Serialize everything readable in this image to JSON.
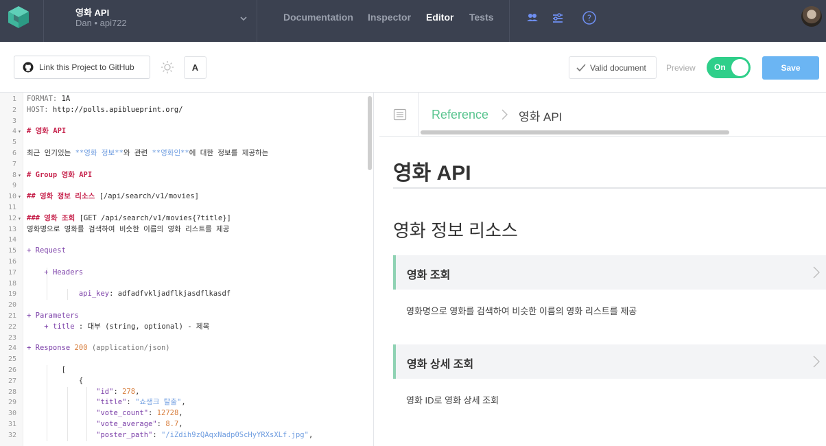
{
  "nav": {
    "project_name": "영화 API",
    "project_sub": "Dan • api722",
    "links": [
      "Documentation",
      "Inspector",
      "Editor",
      "Tests"
    ],
    "active_link": "Editor"
  },
  "toolbar": {
    "github_label": "Link this Project to GitHub",
    "font_button": "A",
    "valid_label": "Valid document",
    "preview_label": "Preview",
    "toggle_label": "On",
    "save_label": "Save"
  },
  "editor": {
    "lines": [
      {
        "n": "1",
        "t": "FORMAT: 1A"
      },
      {
        "n": "2",
        "t": "HOST: http://polls.apiblueprint.org/"
      },
      {
        "n": "3",
        "t": ""
      },
      {
        "n": "4",
        "t": "# 영화 API",
        "fold": true
      },
      {
        "n": "5",
        "t": ""
      },
      {
        "n": "6",
        "t": "최근 인기있는 **영화 정보**와 관련 **영화인**에 대한 정보를 제공하는"
      },
      {
        "n": "7",
        "t": ""
      },
      {
        "n": "8",
        "t": "# Group 영화 API",
        "fold": true
      },
      {
        "n": "9",
        "t": ""
      },
      {
        "n": "10",
        "t": "## 영화 정보 리소스 [/api/search/v1/movies]",
        "fold": true
      },
      {
        "n": "11",
        "t": ""
      },
      {
        "n": "12",
        "t": "### 영화 조회 [GET /api/search/v1/movies{?title}]",
        "fold": true
      },
      {
        "n": "13",
        "t": "영화명으로 영화를 검색하여 비슷한 이름의 영화 리스트를 제공"
      },
      {
        "n": "14",
        "t": ""
      },
      {
        "n": "15",
        "t": "+ Request"
      },
      {
        "n": "16",
        "t": ""
      },
      {
        "n": "17",
        "t": "    + Headers"
      },
      {
        "n": "18",
        "t": ""
      },
      {
        "n": "19",
        "t": "            api_key: adfadfvkljadflkjasdflkasdf"
      },
      {
        "n": "20",
        "t": ""
      },
      {
        "n": "21",
        "t": "+ Parameters"
      },
      {
        "n": "22",
        "t": "    + title : 대부 (string, optional) - 제목"
      },
      {
        "n": "23",
        "t": ""
      },
      {
        "n": "24",
        "t": "+ Response 200 (application/json)"
      },
      {
        "n": "25",
        "t": ""
      },
      {
        "n": "26",
        "t": "        ["
      },
      {
        "n": "27",
        "t": "            {"
      },
      {
        "n": "28",
        "t": "                \"id\": 278,"
      },
      {
        "n": "29",
        "t": "                \"title\": \"쇼생크 탈출\","
      },
      {
        "n": "30",
        "t": "                \"vote_count\": 12728,"
      },
      {
        "n": "31",
        "t": "                \"vote_average\": 8.7,"
      },
      {
        "n": "32",
        "t": "                \"poster_path\": \"/iZdih9zQAqxNadp0ScHyYRXsXLf.jpg\","
      }
    ]
  },
  "preview": {
    "crumb_ref": "Reference",
    "crumb_current": "영화 API",
    "title": "영화 API",
    "resource": "영화 정보 리소스",
    "actions": [
      {
        "title": "영화 조회",
        "desc": "영화명으로 영화를 검색하여 비슷한 이름의 영화 리스트를 제공"
      },
      {
        "title": "영화 상세 조회",
        "desc": "영화 ID로 영화 상세 조회"
      }
    ]
  },
  "colors": {
    "nav_bg": "#3b4150",
    "accent_green": "#2fcf8a",
    "save_blue": "#6bb5f3",
    "reference_green": "#58c48e"
  }
}
